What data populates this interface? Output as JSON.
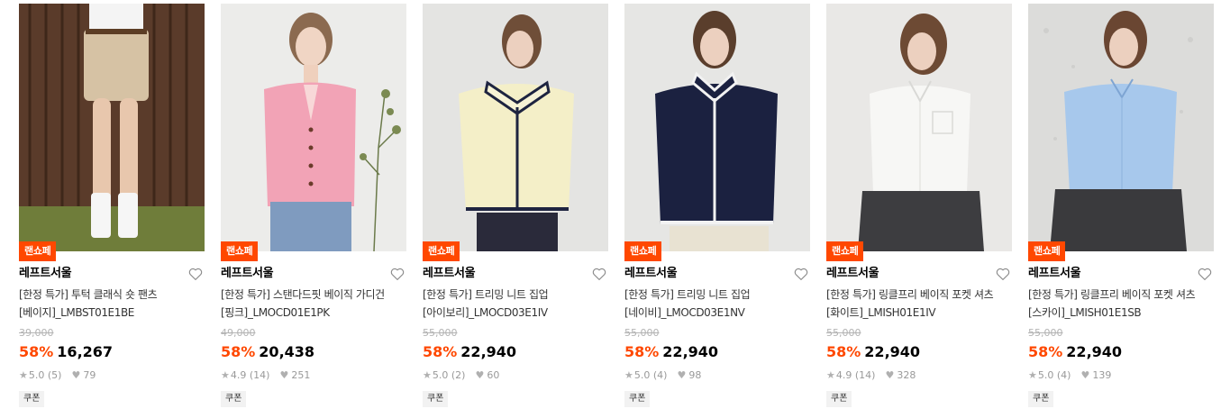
{
  "colors": {
    "accent": "#ff4800",
    "text": "#000000",
    "muted": "#999999"
  },
  "products": [
    {
      "event_tag": "랜쇼페",
      "brand": "레프트서울",
      "name": "[한정 특가] 투턱 클래식 숏 팬츠 [베이지]_LMBST01E1BE",
      "original_price": "39,000",
      "discount": "58%",
      "price": "16,267",
      "rating": "5.0",
      "reviews": "(5)",
      "likes": "79",
      "coupon": "쿠폰",
      "wishlist_icon": "heart-outline-icon"
    },
    {
      "event_tag": "랜쇼페",
      "brand": "레프트서울",
      "name": "[한정 특가] 스탠다드핏 베이직 가디건 [핑크]_LMOCD01E1PK",
      "original_price": "49,000",
      "discount": "58%",
      "price": "20,438",
      "rating": "4.9",
      "reviews": "(14)",
      "likes": "251",
      "coupon": "쿠폰",
      "wishlist_icon": "heart-outline-icon"
    },
    {
      "event_tag": "랜쇼페",
      "brand": "레프트서울",
      "name": "[한정 특가] 트리밍 니트 집업 [아이보리]_LMOCD03E1IV",
      "original_price": "55,000",
      "discount": "58%",
      "price": "22,940",
      "rating": "5.0",
      "reviews": "(2)",
      "likes": "60",
      "coupon": "쿠폰",
      "wishlist_icon": "heart-outline-icon"
    },
    {
      "event_tag": "랜쇼페",
      "brand": "레프트서울",
      "name": "[한정 특가] 트리밍 니트 집업 [네이비]_LMOCD03E1NV",
      "original_price": "55,000",
      "discount": "58%",
      "price": "22,940",
      "rating": "5.0",
      "reviews": "(4)",
      "likes": "98",
      "coupon": "쿠폰",
      "wishlist_icon": "heart-outline-icon"
    },
    {
      "event_tag": "랜쇼페",
      "brand": "레프트서울",
      "name": "[한정 특가] 링클프리 베이직 포켓 셔츠 [화이트]_LMISH01E1IV",
      "original_price": "55,000",
      "discount": "58%",
      "price": "22,940",
      "rating": "4.9",
      "reviews": "(14)",
      "likes": "328",
      "coupon": "쿠폰",
      "wishlist_icon": "heart-outline-icon"
    },
    {
      "event_tag": "랜쇼페",
      "brand": "레프트서울",
      "name": "[한정 특가] 링클프리 베이직 포켓 셔츠 [스카이]_LMISH01E1SB",
      "original_price": "55,000",
      "discount": "58%",
      "price": "22,940",
      "rating": "5.0",
      "reviews": "(4)",
      "likes": "139",
      "coupon": "쿠폰",
      "wishlist_icon": "heart-outline-icon"
    }
  ]
}
